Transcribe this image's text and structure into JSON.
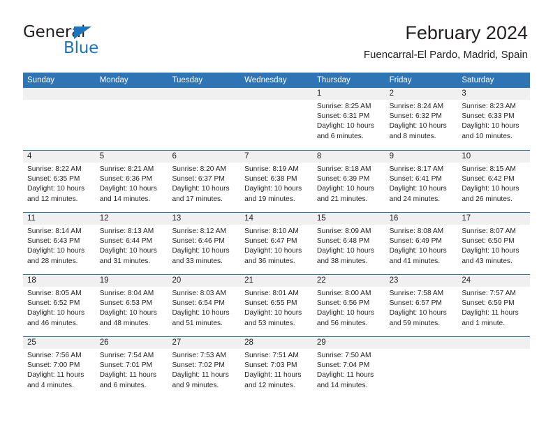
{
  "brand": {
    "name_top": "General",
    "name_bottom": "Blue",
    "accent_color": "#1e74bb"
  },
  "header": {
    "title": "February 2024",
    "subtitle": "Fuencarral-El Pardo, Madrid, Spain"
  },
  "theme": {
    "header_bg": "#2e75b6",
    "day_band_bg": "#f0f0f0",
    "text_color": "#231f20"
  },
  "weekdays": [
    "Sunday",
    "Monday",
    "Tuesday",
    "Wednesday",
    "Thursday",
    "Friday",
    "Saturday"
  ],
  "weeks": [
    [
      {
        "day": "",
        "empty": true,
        "sunrise": "",
        "sunset": "",
        "daylight_line1": "",
        "daylight_line2": ""
      },
      {
        "day": "",
        "empty": true,
        "sunrise": "",
        "sunset": "",
        "daylight_line1": "",
        "daylight_line2": ""
      },
      {
        "day": "",
        "empty": true,
        "sunrise": "",
        "sunset": "",
        "daylight_line1": "",
        "daylight_line2": ""
      },
      {
        "day": "",
        "empty": true,
        "sunrise": "",
        "sunset": "",
        "daylight_line1": "",
        "daylight_line2": ""
      },
      {
        "day": "1",
        "empty": false,
        "sunrise": "Sunrise: 8:25 AM",
        "sunset": "Sunset: 6:31 PM",
        "daylight_line1": "Daylight: 10 hours",
        "daylight_line2": "and 6 minutes."
      },
      {
        "day": "2",
        "empty": false,
        "sunrise": "Sunrise: 8:24 AM",
        "sunset": "Sunset: 6:32 PM",
        "daylight_line1": "Daylight: 10 hours",
        "daylight_line2": "and 8 minutes."
      },
      {
        "day": "3",
        "empty": false,
        "sunrise": "Sunrise: 8:23 AM",
        "sunset": "Sunset: 6:33 PM",
        "daylight_line1": "Daylight: 10 hours",
        "daylight_line2": "and 10 minutes."
      }
    ],
    [
      {
        "day": "4",
        "empty": false,
        "sunrise": "Sunrise: 8:22 AM",
        "sunset": "Sunset: 6:35 PM",
        "daylight_line1": "Daylight: 10 hours",
        "daylight_line2": "and 12 minutes."
      },
      {
        "day": "5",
        "empty": false,
        "sunrise": "Sunrise: 8:21 AM",
        "sunset": "Sunset: 6:36 PM",
        "daylight_line1": "Daylight: 10 hours",
        "daylight_line2": "and 14 minutes."
      },
      {
        "day": "6",
        "empty": false,
        "sunrise": "Sunrise: 8:20 AM",
        "sunset": "Sunset: 6:37 PM",
        "daylight_line1": "Daylight: 10 hours",
        "daylight_line2": "and 17 minutes."
      },
      {
        "day": "7",
        "empty": false,
        "sunrise": "Sunrise: 8:19 AM",
        "sunset": "Sunset: 6:38 PM",
        "daylight_line1": "Daylight: 10 hours",
        "daylight_line2": "and 19 minutes."
      },
      {
        "day": "8",
        "empty": false,
        "sunrise": "Sunrise: 8:18 AM",
        "sunset": "Sunset: 6:39 PM",
        "daylight_line1": "Daylight: 10 hours",
        "daylight_line2": "and 21 minutes."
      },
      {
        "day": "9",
        "empty": false,
        "sunrise": "Sunrise: 8:17 AM",
        "sunset": "Sunset: 6:41 PM",
        "daylight_line1": "Daylight: 10 hours",
        "daylight_line2": "and 24 minutes."
      },
      {
        "day": "10",
        "empty": false,
        "sunrise": "Sunrise: 8:15 AM",
        "sunset": "Sunset: 6:42 PM",
        "daylight_line1": "Daylight: 10 hours",
        "daylight_line2": "and 26 minutes."
      }
    ],
    [
      {
        "day": "11",
        "empty": false,
        "sunrise": "Sunrise: 8:14 AM",
        "sunset": "Sunset: 6:43 PM",
        "daylight_line1": "Daylight: 10 hours",
        "daylight_line2": "and 28 minutes."
      },
      {
        "day": "12",
        "empty": false,
        "sunrise": "Sunrise: 8:13 AM",
        "sunset": "Sunset: 6:44 PM",
        "daylight_line1": "Daylight: 10 hours",
        "daylight_line2": "and 31 minutes."
      },
      {
        "day": "13",
        "empty": false,
        "sunrise": "Sunrise: 8:12 AM",
        "sunset": "Sunset: 6:46 PM",
        "daylight_line1": "Daylight: 10 hours",
        "daylight_line2": "and 33 minutes."
      },
      {
        "day": "14",
        "empty": false,
        "sunrise": "Sunrise: 8:10 AM",
        "sunset": "Sunset: 6:47 PM",
        "daylight_line1": "Daylight: 10 hours",
        "daylight_line2": "and 36 minutes."
      },
      {
        "day": "15",
        "empty": false,
        "sunrise": "Sunrise: 8:09 AM",
        "sunset": "Sunset: 6:48 PM",
        "daylight_line1": "Daylight: 10 hours",
        "daylight_line2": "and 38 minutes."
      },
      {
        "day": "16",
        "empty": false,
        "sunrise": "Sunrise: 8:08 AM",
        "sunset": "Sunset: 6:49 PM",
        "daylight_line1": "Daylight: 10 hours",
        "daylight_line2": "and 41 minutes."
      },
      {
        "day": "17",
        "empty": false,
        "sunrise": "Sunrise: 8:07 AM",
        "sunset": "Sunset: 6:50 PM",
        "daylight_line1": "Daylight: 10 hours",
        "daylight_line2": "and 43 minutes."
      }
    ],
    [
      {
        "day": "18",
        "empty": false,
        "sunrise": "Sunrise: 8:05 AM",
        "sunset": "Sunset: 6:52 PM",
        "daylight_line1": "Daylight: 10 hours",
        "daylight_line2": "and 46 minutes."
      },
      {
        "day": "19",
        "empty": false,
        "sunrise": "Sunrise: 8:04 AM",
        "sunset": "Sunset: 6:53 PM",
        "daylight_line1": "Daylight: 10 hours",
        "daylight_line2": "and 48 minutes."
      },
      {
        "day": "20",
        "empty": false,
        "sunrise": "Sunrise: 8:03 AM",
        "sunset": "Sunset: 6:54 PM",
        "daylight_line1": "Daylight: 10 hours",
        "daylight_line2": "and 51 minutes."
      },
      {
        "day": "21",
        "empty": false,
        "sunrise": "Sunrise: 8:01 AM",
        "sunset": "Sunset: 6:55 PM",
        "daylight_line1": "Daylight: 10 hours",
        "daylight_line2": "and 53 minutes."
      },
      {
        "day": "22",
        "empty": false,
        "sunrise": "Sunrise: 8:00 AM",
        "sunset": "Sunset: 6:56 PM",
        "daylight_line1": "Daylight: 10 hours",
        "daylight_line2": "and 56 minutes."
      },
      {
        "day": "23",
        "empty": false,
        "sunrise": "Sunrise: 7:58 AM",
        "sunset": "Sunset: 6:57 PM",
        "daylight_line1": "Daylight: 10 hours",
        "daylight_line2": "and 59 minutes."
      },
      {
        "day": "24",
        "empty": false,
        "sunrise": "Sunrise: 7:57 AM",
        "sunset": "Sunset: 6:59 PM",
        "daylight_line1": "Daylight: 11 hours",
        "daylight_line2": "and 1 minute."
      }
    ],
    [
      {
        "day": "25",
        "empty": false,
        "sunrise": "Sunrise: 7:56 AM",
        "sunset": "Sunset: 7:00 PM",
        "daylight_line1": "Daylight: 11 hours",
        "daylight_line2": "and 4 minutes."
      },
      {
        "day": "26",
        "empty": false,
        "sunrise": "Sunrise: 7:54 AM",
        "sunset": "Sunset: 7:01 PM",
        "daylight_line1": "Daylight: 11 hours",
        "daylight_line2": "and 6 minutes."
      },
      {
        "day": "27",
        "empty": false,
        "sunrise": "Sunrise: 7:53 AM",
        "sunset": "Sunset: 7:02 PM",
        "daylight_line1": "Daylight: 11 hours",
        "daylight_line2": "and 9 minutes."
      },
      {
        "day": "28",
        "empty": false,
        "sunrise": "Sunrise: 7:51 AM",
        "sunset": "Sunset: 7:03 PM",
        "daylight_line1": "Daylight: 11 hours",
        "daylight_line2": "and 12 minutes."
      },
      {
        "day": "29",
        "empty": false,
        "sunrise": "Sunrise: 7:50 AM",
        "sunset": "Sunset: 7:04 PM",
        "daylight_line1": "Daylight: 11 hours",
        "daylight_line2": "and 14 minutes."
      },
      {
        "day": "",
        "empty": true,
        "sunrise": "",
        "sunset": "",
        "daylight_line1": "",
        "daylight_line2": ""
      },
      {
        "day": "",
        "empty": true,
        "sunrise": "",
        "sunset": "",
        "daylight_line1": "",
        "daylight_line2": ""
      }
    ]
  ]
}
